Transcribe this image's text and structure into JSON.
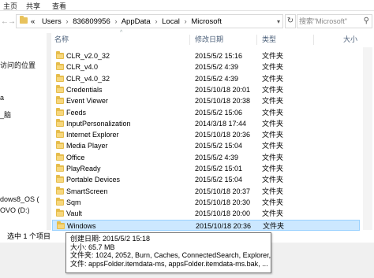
{
  "ribbon": {
    "tabs": [
      "主页",
      "共享",
      "查看"
    ]
  },
  "address": {
    "back_glyph": "←",
    "forward_glyph": "→",
    "overflow_glyph": "«",
    "path": [
      "Users",
      "836809956",
      "AppData",
      "Local",
      "Microsoft"
    ],
    "separator": "›",
    "dropdown_glyph": "▾",
    "refresh_glyph": "↻"
  },
  "search": {
    "placeholder": "搜索\"Microsoft\"",
    "icon": "search-icon"
  },
  "columns": {
    "name": "名称",
    "date": "修改日期",
    "type": "类型",
    "size": "大小"
  },
  "nav": {
    "items": [
      "访问的位置",
      "a",
      "_脑",
      "dows8_OS (",
      "OVO (D:)"
    ]
  },
  "files": [
    {
      "name": "CLR_v2.0_32",
      "date": "2015/5/2 15:16",
      "type": "文件夹"
    },
    {
      "name": "CLR_v4.0",
      "date": "2015/5/2 4:39",
      "type": "文件夹"
    },
    {
      "name": "CLR_v4.0_32",
      "date": "2015/5/2 4:39",
      "type": "文件夹"
    },
    {
      "name": "Credentials",
      "date": "2015/10/18 20:01",
      "type": "文件夹"
    },
    {
      "name": "Event Viewer",
      "date": "2015/10/18 20:38",
      "type": "文件夹"
    },
    {
      "name": "Feeds",
      "date": "2015/5/2 15:06",
      "type": "文件夹"
    },
    {
      "name": "InputPersonalization",
      "date": "2014/3/18 17:44",
      "type": "文件夹"
    },
    {
      "name": "Internet Explorer",
      "date": "2015/10/18 20:36",
      "type": "文件夹"
    },
    {
      "name": "Media Player",
      "date": "2015/5/2 15:04",
      "type": "文件夹"
    },
    {
      "name": "Office",
      "date": "2015/5/2 4:39",
      "type": "文件夹"
    },
    {
      "name": "PlayReady",
      "date": "2015/5/2 15:01",
      "type": "文件夹"
    },
    {
      "name": "Portable Devices",
      "date": "2015/5/2 15:04",
      "type": "文件夹"
    },
    {
      "name": "SmartScreen",
      "date": "2015/10/18 20:37",
      "type": "文件夹"
    },
    {
      "name": "Sqm",
      "date": "2015/10/18 20:30",
      "type": "文件夹"
    },
    {
      "name": "Vault",
      "date": "2015/10/18 20:00",
      "type": "文件夹"
    },
    {
      "name": "Windows",
      "date": "2015/10/18 20:36",
      "type": "文件夹"
    }
  ],
  "selected_index": 15,
  "tooltip": {
    "lines": [
      "创建日期: 2015/5/2 15:18",
      "大小: 65.7 MB",
      "文件夹: 1024, 2052, Burn, Caches, ConnectedSearch, Explorer, ...",
      "文件: appsFolder.itemdata-ms, appsFolder.itemdata-ms.bak, ..."
    ]
  },
  "status": {
    "selection": "选中 1 个项目"
  },
  "colors": {
    "selection_bg": "#cce8ff",
    "folder": "#e6bd4c",
    "header_text": "#4c607a"
  }
}
